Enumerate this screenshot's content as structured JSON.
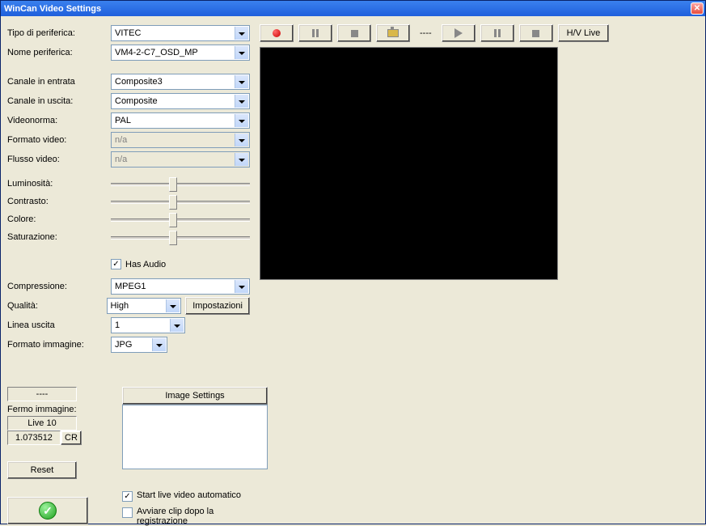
{
  "window": {
    "title": "WinCan Video Settings"
  },
  "labels": {
    "device_type": "Tipo di periferica:",
    "device_name": "Nome periferica:",
    "channel_in": "Canale in entrata",
    "channel_out": "Canale in uscita:",
    "videonorm": "Videonorma:",
    "video_format": "Formato video:",
    "video_stream": "Flusso video:",
    "brightness": "Luminosità:",
    "contrast": "Contrasto:",
    "color": "Colore:",
    "saturation": "Saturazione:",
    "has_audio": "Has Audio",
    "compression": "Compressione:",
    "quality": "Qualità:",
    "settings_btn": "Impostazioni",
    "line_out": "Linea uscita",
    "image_format": "Formato immagine:",
    "image_settings": "Image Settings",
    "freeze_image": "Fermo immagine:",
    "live10": "Live 10",
    "cr": "CR",
    "reset": "Reset",
    "start_live_auto": "Start live video automatico",
    "start_clip_after": "Avviare clip dopo la registrazione",
    "hv_live": "H/V Live"
  },
  "values": {
    "device_type": "VITEC",
    "device_name": "VM4-2-C7_OSD_MP",
    "channel_in": "Composite3",
    "channel_out": "Composite",
    "videonorm": "PAL",
    "video_format": "n/a",
    "video_stream": "n/a",
    "compression": "MPEG1",
    "quality": "High",
    "line_out": "1",
    "image_format": "JPG",
    "status_dash": "----",
    "ratio": "1.073512",
    "toolbar_dash": "----"
  },
  "checks": {
    "has_audio": "✓",
    "start_live_auto": "✓",
    "start_clip_after": ""
  }
}
